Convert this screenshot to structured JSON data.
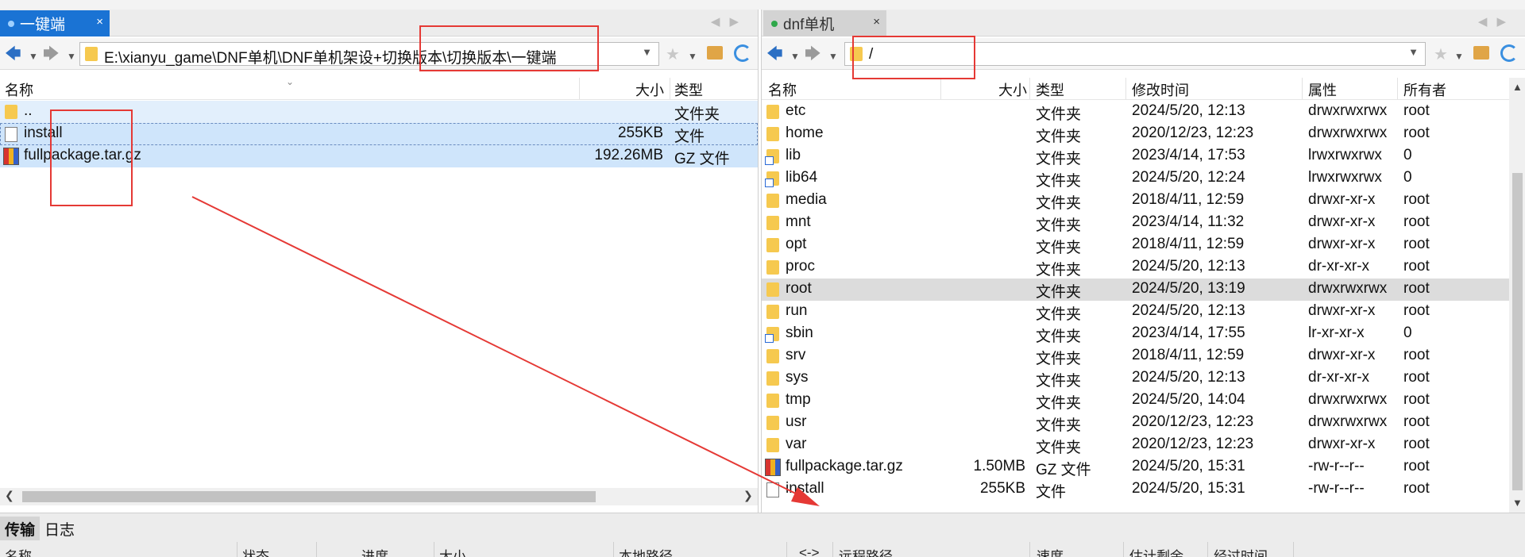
{
  "left": {
    "tab_label": "一键端",
    "tab_close": "×",
    "path": "E:\\xianyu_game\\DNF单机\\DNF单机架设+切换版本\\切换版本\\一键端",
    "columns": {
      "name": "名称",
      "size": "大小",
      "type": "类型"
    },
    "rows": [
      {
        "name": "..",
        "size": "",
        "type": "文件夹",
        "icon": "folder-icon"
      },
      {
        "name": "install",
        "size": "255KB",
        "type": "文件",
        "icon": "file-icon"
      },
      {
        "name": "fullpackage.tar.gz",
        "size": "192.26MB",
        "type": "GZ 文件",
        "icon": "archive-icon"
      }
    ]
  },
  "right": {
    "tab_label": "dnf单机",
    "tab_close": "×",
    "path": "/",
    "columns": {
      "name": "名称",
      "size": "大小",
      "type": "类型",
      "mtime": "修改时间",
      "attr": "属性",
      "owner": "所有者"
    },
    "rows": [
      {
        "name": "etc",
        "size": "",
        "type": "文件夹",
        "mtime": "2024/5/20, 12:13",
        "attr": "drwxrwxrwx",
        "owner": "root",
        "icon": "folder-icon"
      },
      {
        "name": "home",
        "size": "",
        "type": "文件夹",
        "mtime": "2020/12/23, 12:23",
        "attr": "drwxrwxrwx",
        "owner": "root",
        "icon": "folder-icon"
      },
      {
        "name": "lib",
        "size": "",
        "type": "文件夹",
        "mtime": "2023/4/14, 17:53",
        "attr": "lrwxrwxrwx",
        "owner": "0",
        "icon": "folder-link-icon"
      },
      {
        "name": "lib64",
        "size": "",
        "type": "文件夹",
        "mtime": "2024/5/20, 12:24",
        "attr": "lrwxrwxrwx",
        "owner": "0",
        "icon": "folder-link-icon"
      },
      {
        "name": "media",
        "size": "",
        "type": "文件夹",
        "mtime": "2018/4/11, 12:59",
        "attr": "drwxr-xr-x",
        "owner": "root",
        "icon": "folder-icon"
      },
      {
        "name": "mnt",
        "size": "",
        "type": "文件夹",
        "mtime": "2023/4/14, 11:32",
        "attr": "drwxr-xr-x",
        "owner": "root",
        "icon": "folder-icon"
      },
      {
        "name": "opt",
        "size": "",
        "type": "文件夹",
        "mtime": "2018/4/11, 12:59",
        "attr": "drwxr-xr-x",
        "owner": "root",
        "icon": "folder-icon"
      },
      {
        "name": "proc",
        "size": "",
        "type": "文件夹",
        "mtime": "2024/5/20, 12:13",
        "attr": "dr-xr-xr-x",
        "owner": "root",
        "icon": "folder-icon"
      },
      {
        "name": "root",
        "size": "",
        "type": "文件夹",
        "mtime": "2024/5/20, 13:19",
        "attr": "drwxrwxrwx",
        "owner": "root",
        "icon": "folder-icon",
        "highlight": true
      },
      {
        "name": "run",
        "size": "",
        "type": "文件夹",
        "mtime": "2024/5/20, 12:13",
        "attr": "drwxr-xr-x",
        "owner": "root",
        "icon": "folder-icon"
      },
      {
        "name": "sbin",
        "size": "",
        "type": "文件夹",
        "mtime": "2023/4/14, 17:55",
        "attr": "lr-xr-xr-x",
        "owner": "0",
        "icon": "folder-link-icon"
      },
      {
        "name": "srv",
        "size": "",
        "type": "文件夹",
        "mtime": "2018/4/11, 12:59",
        "attr": "drwxr-xr-x",
        "owner": "root",
        "icon": "folder-icon"
      },
      {
        "name": "sys",
        "size": "",
        "type": "文件夹",
        "mtime": "2024/5/20, 12:13",
        "attr": "dr-xr-xr-x",
        "owner": "root",
        "icon": "folder-icon"
      },
      {
        "name": "tmp",
        "size": "",
        "type": "文件夹",
        "mtime": "2024/5/20, 14:04",
        "attr": "drwxrwxrwx",
        "owner": "root",
        "icon": "folder-icon"
      },
      {
        "name": "usr",
        "size": "",
        "type": "文件夹",
        "mtime": "2020/12/23, 12:23",
        "attr": "drwxrwxrwx",
        "owner": "root",
        "icon": "folder-icon"
      },
      {
        "name": "var",
        "size": "",
        "type": "文件夹",
        "mtime": "2020/12/23, 12:23",
        "attr": "drwxr-xr-x",
        "owner": "root",
        "icon": "folder-icon"
      },
      {
        "name": "fullpackage.tar.gz",
        "size": "1.50MB",
        "type": "GZ 文件",
        "mtime": "2024/5/20, 15:31",
        "attr": "-rw-r--r--",
        "owner": "root",
        "icon": "archive-icon"
      },
      {
        "name": "install",
        "size": "255KB",
        "type": "文件",
        "mtime": "2024/5/20, 15:31",
        "attr": "-rw-r--r--",
        "owner": "root",
        "icon": "file-icon"
      }
    ]
  },
  "transfer": {
    "tabs": [
      "传输",
      "日志"
    ],
    "columns": [
      "名称",
      "状态",
      "进度",
      "大小",
      "本地路径",
      "<->",
      "远程路径",
      "速度",
      "估计剩余...",
      "经过时间"
    ]
  },
  "colors": {
    "accent": "#1a73d4",
    "annotation": "#e53935",
    "selection": "#cfe5fb"
  }
}
